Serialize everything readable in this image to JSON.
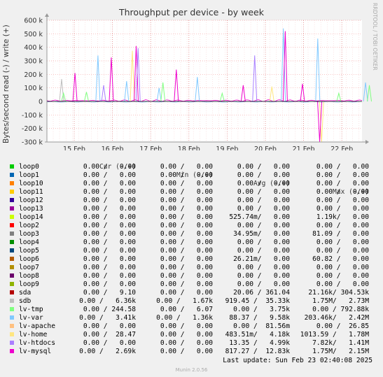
{
  "chart_data": {
    "type": "line",
    "title": "Throughput per device - by week",
    "ylabel": "Bytes/second read (-) / write (+)",
    "yticks": [
      "600 k",
      "500 k",
      "400 k",
      "300 k",
      "200 k",
      "100 k",
      "0",
      "-100 k",
      "-200 k",
      "-300 k"
    ],
    "ylim": [
      -300000,
      600000
    ],
    "xticks": [
      "15 Feb",
      "16 Feb",
      "17 Feb",
      "18 Feb",
      "19 Feb",
      "20 Feb",
      "21 Feb",
      "22 Feb"
    ],
    "grid": true,
    "spikes": [
      {
        "series": "sdb",
        "day": 0.0,
        "value": 165000
      },
      {
        "series": "lv-tmp",
        "day": 0.05,
        "value": 60000
      },
      {
        "series": "lv-mysql",
        "day": 0.35,
        "value": 210000
      },
      {
        "series": "lv-tmp",
        "day": 0.65,
        "value": 70000
      },
      {
        "series": "lv-var",
        "day": 0.95,
        "value": 340000
      },
      {
        "series": "lv-htdocs",
        "day": 1.1,
        "value": 120000
      },
      {
        "series": "lv-mysql",
        "day": 1.3,
        "value": 325000
      },
      {
        "series": "lv-var",
        "day": 1.7,
        "value": 150000
      },
      {
        "series": "lv-home",
        "day": 1.85,
        "value": 375000
      },
      {
        "series": "lv-mysql",
        "day": 1.95,
        "value": 410000
      },
      {
        "series": "lv-htdocs",
        "day": 2.0,
        "value": 395000
      },
      {
        "series": "lv-var",
        "day": 2.55,
        "value": 100000
      },
      {
        "series": "lv-tmp",
        "day": 2.65,
        "value": 140000
      },
      {
        "series": "lv-mysql",
        "day": 3.0,
        "value": 235000
      },
      {
        "series": "lv-var",
        "day": 3.55,
        "value": 180000
      },
      {
        "series": "lv-tmp",
        "day": 4.2,
        "value": 60000
      },
      {
        "series": "lv-mysql",
        "day": 4.75,
        "value": 120000
      },
      {
        "series": "lv-htdocs",
        "day": 5.05,
        "value": 340000
      },
      {
        "series": "lv-home",
        "day": 5.5,
        "value": 110000
      },
      {
        "series": "lv-var",
        "day": 5.8,
        "value": 540000
      },
      {
        "series": "lv-mysql",
        "day": 5.85,
        "value": 520000
      },
      {
        "series": "lv-mysql",
        "day": 6.3,
        "value": 130000
      },
      {
        "series": "lv-var",
        "day": 6.7,
        "value": 465000
      },
      {
        "series": "lv-home",
        "day": 6.8,
        "value": -300000
      },
      {
        "series": "lv-mysql",
        "day": 6.75,
        "value": -300000
      },
      {
        "series": "lv-tmp",
        "day": 7.25,
        "value": 60000
      },
      {
        "series": "lv-var",
        "day": 7.95,
        "value": 140000
      },
      {
        "series": "lv-tmp",
        "day": 8.05,
        "value": 120000
      }
    ]
  },
  "side_label": "RRDTOOL / TOBI OETIKER",
  "legend_header": {
    "cur": "Cur (-/+)",
    "min": "Min (-/+)",
    "avg": "Avg (-/+)",
    "max": "Max (-/+)"
  },
  "legend": [
    {
      "name": "loop0",
      "color": "#00cc00",
      "cur": "0.00 /   0.00",
      "min": "0.00 /   0.00",
      "avg": "0.00 /   0.00",
      "max": "0.00 /   0.00"
    },
    {
      "name": "loop1",
      "color": "#0066b3",
      "cur": "0.00 /   0.00",
      "min": "0.00 /   0.00",
      "avg": "0.00 /   0.00",
      "max": "0.00 /   0.00"
    },
    {
      "name": "loop10",
      "color": "#ff8000",
      "cur": "0.00 /   0.00",
      "min": "0.00 /   0.00",
      "avg": "0.00 /   0.00",
      "max": "0.00 /   0.00"
    },
    {
      "name": "loop11",
      "color": "#ffcc00",
      "cur": "0.00 /   0.00",
      "min": "0.00 /   0.00",
      "avg": "0.00 /   0.00",
      "max": "0.00 /   0.00"
    },
    {
      "name": "loop12",
      "color": "#330099",
      "cur": "0.00 /   0.00",
      "min": "0.00 /   0.00",
      "avg": "0.00 /   0.00",
      "max": "0.00 /   0.00"
    },
    {
      "name": "loop13",
      "color": "#990099",
      "cur": "0.00 /   0.00",
      "min": "0.00 /   0.00",
      "avg": "0.00 /   0.00",
      "max": "0.00 /   0.00"
    },
    {
      "name": "loop14",
      "color": "#ccff00",
      "cur": "0.00 /   0.00",
      "min": "0.00 /   0.00",
      "avg": "525.74m/   0.00",
      "max": "1.19k/   0.00"
    },
    {
      "name": "loop2",
      "color": "#ff0000",
      "cur": "0.00 /   0.00",
      "min": "0.00 /   0.00",
      "avg": "0.00 /   0.00",
      "max": "0.00 /   0.00"
    },
    {
      "name": "loop3",
      "color": "#808080",
      "cur": "0.00 /   0.00",
      "min": "0.00 /   0.00",
      "avg": "34.95m/   0.00",
      "max": "81.09 /   0.00"
    },
    {
      "name": "loop4",
      "color": "#008f00",
      "cur": "0.00 /   0.00",
      "min": "0.00 /   0.00",
      "avg": "0.00 /   0.00",
      "max": "0.00 /   0.00"
    },
    {
      "name": "loop5",
      "color": "#00487d",
      "cur": "0.00 /   0.00",
      "min": "0.00 /   0.00",
      "avg": "0.00 /   0.00",
      "max": "0.00 /   0.00"
    },
    {
      "name": "loop6",
      "color": "#b35a00",
      "cur": "0.00 /   0.00",
      "min": "0.00 /   0.00",
      "avg": "26.21m/   0.00",
      "max": "60.82 /   0.00"
    },
    {
      "name": "loop7",
      "color": "#b38f00",
      "cur": "0.00 /   0.00",
      "min": "0.00 /   0.00",
      "avg": "0.00 /   0.00",
      "max": "0.00 /   0.00"
    },
    {
      "name": "loop8",
      "color": "#6b006b",
      "cur": "0.00 /   0.00",
      "min": "0.00 /   0.00",
      "avg": "0.00 /   0.00",
      "max": "0.00 /   0.00"
    },
    {
      "name": "loop9",
      "color": "#8fb300",
      "cur": "0.00 /   0.00",
      "min": "0.00 /   0.00",
      "avg": "0.00 /   0.00",
      "max": "0.00 /   0.00"
    },
    {
      "name": "sda",
      "color": "#b30000",
      "cur": "0.00 /   9.10",
      "min": "0.00 /   0.00",
      "avg": "20.06 / 361.04",
      "max": "21.16k/ 304.53k"
    },
    {
      "name": "sdb",
      "color": "#bebebe",
      "cur": "0.00 /   6.36k",
      "min": "0.00 /   1.67k",
      "avg": "919.45 /  35.33k",
      "max": "1.75M/   2.73M"
    },
    {
      "name": "lv-tmp",
      "color": "#80ff80",
      "cur": "0.00 / 244.58",
      "min": "0.00 /   6.07",
      "avg": "0.00 /   3.75k",
      "max": "0.00 / 792.88k"
    },
    {
      "name": "lv-var",
      "color": "#80c9ff",
      "cur": "0.00 /   3.41k",
      "min": "0.00 /   1.36k",
      "avg": "88.37 /   9.58k",
      "max": "203.46k/   2.42M"
    },
    {
      "name": "lv-apache",
      "color": "#ffc080",
      "cur": "0.00 /   0.00",
      "min": "0.00 /   0.00",
      "avg": "0.00 /  81.56m",
      "max": "0.00 /  26.85"
    },
    {
      "name": "lv-home",
      "color": "#ffe680",
      "cur": "0.00 /  28.47",
      "min": "0.00 /   0.00",
      "avg": "483.51m/   4.18k",
      "max": "1013.59 /   1.78M"
    },
    {
      "name": "lv-htdocs",
      "color": "#aa80ff",
      "cur": "0.00 /   0.00",
      "min": "0.00 /   0.00",
      "avg": "13.35 /   4.99k",
      "max": "7.82k/   1.41M"
    },
    {
      "name": "lv-mysql",
      "color": "#ee00cc",
      "cur": "0.00 /   2.69k",
      "min": "0.00 /   0.00",
      "avg": "817.27 /  12.83k",
      "max": "1.75M/   2.15M"
    }
  ],
  "footer": "Last update: Sun Feb 23 02:40:08 2025",
  "munin": "Munin 2.0.56"
}
